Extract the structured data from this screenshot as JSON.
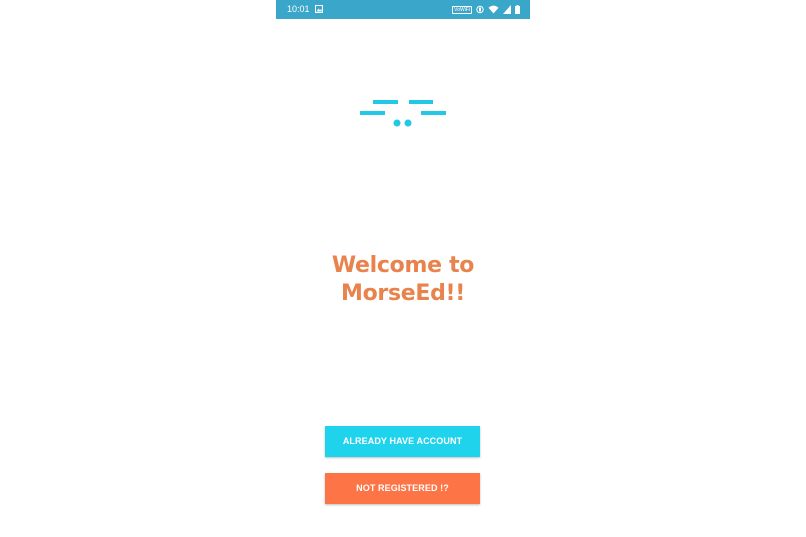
{
  "status_bar": {
    "time": "10:01",
    "network_badge": "VoWiFi",
    "icons": [
      "gallery-icon",
      "vibrate-icon",
      "wifi-icon",
      "signal-icon",
      "battery-icon"
    ]
  },
  "logo": {
    "icon": "morse-logo-icon",
    "color": "#22c8e6"
  },
  "welcome": {
    "line1": "Welcome to",
    "line2": "MorseEd!!",
    "color": "#e8834d"
  },
  "buttons": {
    "login_label": "ALREADY HAVE ACCOUNT",
    "login_color": "#1fd3ec",
    "register_label": "NOT REGISTERED !?",
    "register_color": "#fd7446"
  }
}
